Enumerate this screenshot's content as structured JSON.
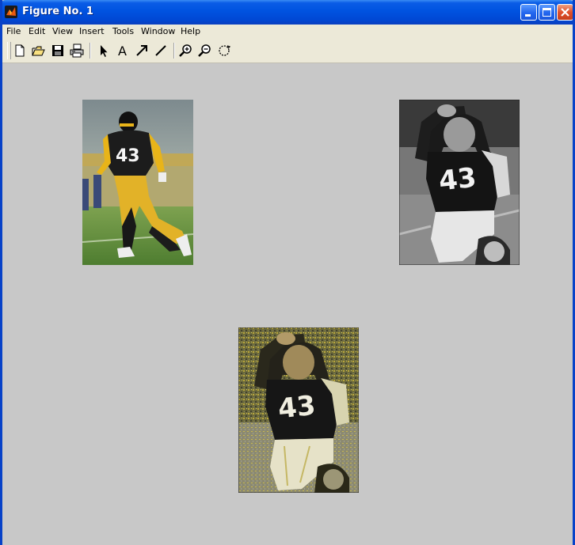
{
  "window": {
    "title": "Figure No. 1"
  },
  "menu": {
    "items": [
      "File",
      "Edit",
      "View",
      "Insert",
      "Tools",
      "Window",
      "Help"
    ]
  },
  "toolbar": {
    "tools": [
      "new-file-icon",
      "open-folder-icon",
      "save-icon",
      "print-icon",
      "select-arrow-icon",
      "insert-text-icon",
      "insert-arrow-icon",
      "insert-line-icon",
      "zoom-in-icon",
      "zoom-out-icon",
      "rotate-3d-icon"
    ]
  },
  "figure": {
    "background": "#c8c8c8",
    "images": [
      {
        "name": "original-color-photo",
        "jersey_number": "43"
      },
      {
        "name": "grayscale-photo",
        "jersey_number": "43"
      },
      {
        "name": "posterized-photo",
        "jersey_number": "43"
      }
    ]
  },
  "colors": {
    "titlebar": "#0053e0",
    "menubar": "#ece9d8",
    "jersey": "#1c1c1c",
    "gold": "#e8b419",
    "field": "#5d8f3a"
  }
}
